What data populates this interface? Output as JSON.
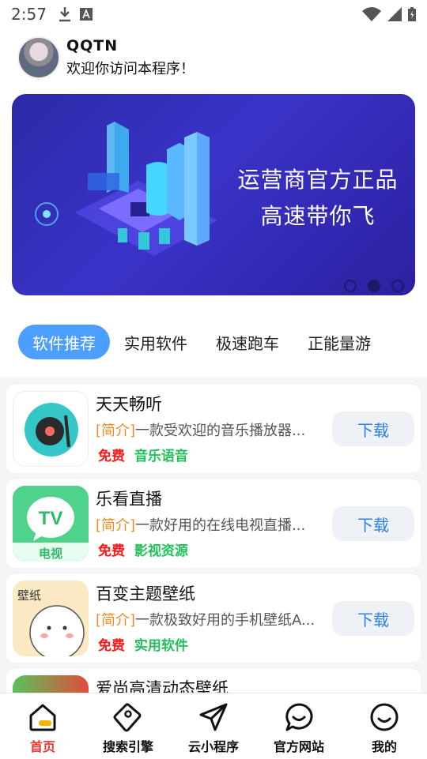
{
  "status_bar": {
    "time": "2:57"
  },
  "header": {
    "user_name": "QQTN",
    "welcome": "欢迎你访问本程序！"
  },
  "banner": {
    "line1": "运营商官方正品",
    "line2": "高速带你飞",
    "active_dot": 2
  },
  "tabs": [
    "软件推荐",
    "实用软件",
    "极速跑车",
    "正能量游"
  ],
  "apps": [
    {
      "name": "天天畅听",
      "desc_tag": "[简介]",
      "desc": "一款受欢迎的音乐播放器...",
      "price": "免费",
      "category": "音乐语音",
      "button": "下载"
    },
    {
      "name": "乐看直播",
      "desc_tag": "[简介]",
      "desc": "一款好用的在线电视直播...",
      "price": "免费",
      "category": "影视资源",
      "button": "下载"
    },
    {
      "name": "百变主题壁纸",
      "desc_tag": "[简介]",
      "desc": "一款极致好用的手机壁纸A...",
      "price": "免费",
      "category": "实用软件",
      "button": "下载"
    },
    {
      "name": "爱尚高清动态壁纸"
    }
  ],
  "app_icons": {
    "tv_badge": "TV",
    "tv_caption": "电视",
    "wallpaper_caption": "壁纸"
  },
  "nav": [
    "首页",
    "搜索引擎",
    "云小程序",
    "官方网站",
    "我的"
  ],
  "colors": {
    "accent": "#4d9fff",
    "free": "#ff1a1a",
    "category": "#22c05a",
    "tag": "#f08a24",
    "nav_active": "#f2322f",
    "banner": "#3a33c8"
  }
}
